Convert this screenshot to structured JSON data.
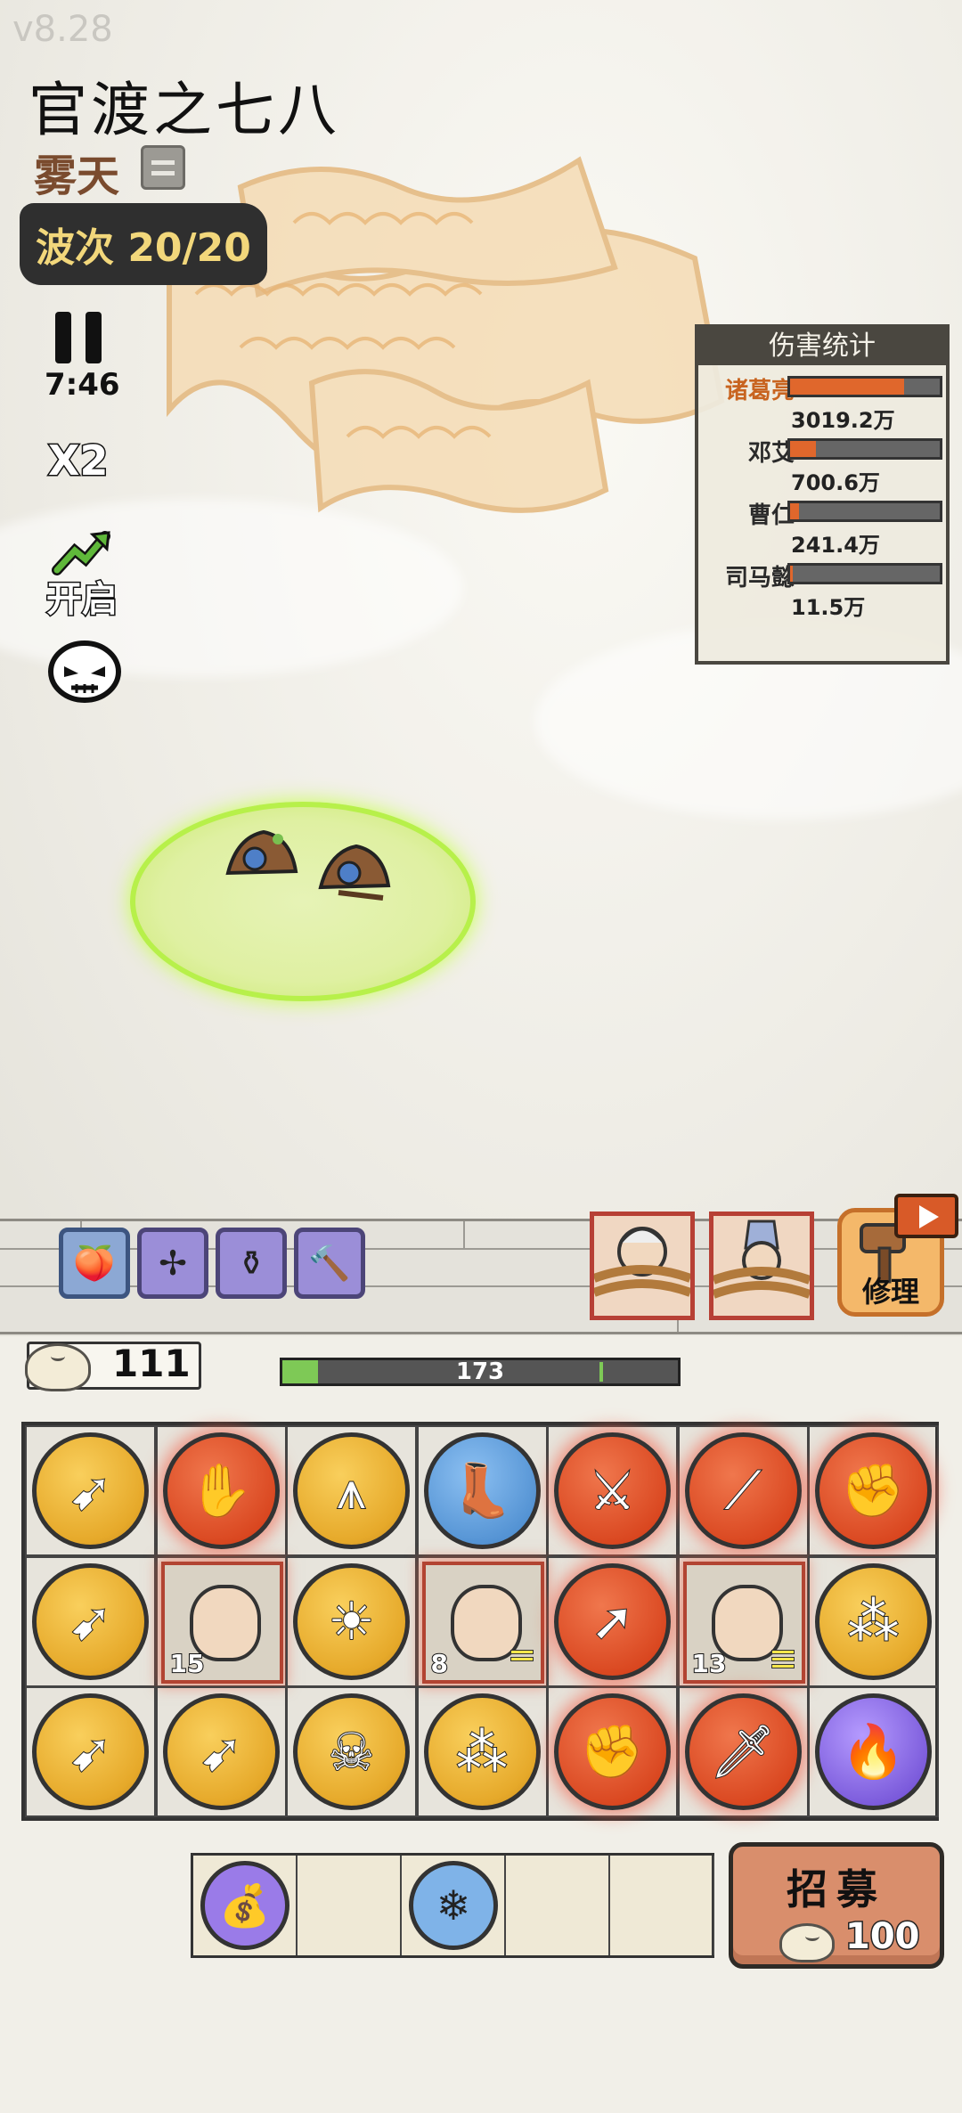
{
  "version": "v8.28",
  "stage": {
    "title": "官渡之七八",
    "weather": "雾天"
  },
  "wave": {
    "label": "波次 20/20"
  },
  "controls": {
    "timer": "7:46",
    "speed": "X2",
    "boost_label": "开启"
  },
  "damage_stats": {
    "title": "伤害统计",
    "rows": [
      {
        "name": "诸葛亮",
        "value": "3019.2万",
        "ratio": 0.76
      },
      {
        "name": "邓艾",
        "value": "700.6万",
        "ratio": 0.17
      },
      {
        "name": "曹仁",
        "value": "241.4万",
        "ratio": 0.06
      },
      {
        "name": "司马懿",
        "value": "11.5万",
        "ratio": 0.005
      }
    ]
  },
  "wall": {
    "repair_label": "修理",
    "hp_value": "173",
    "hp_fraction": 0.09
  },
  "resources": {
    "buns": "111"
  },
  "item_slots": [
    {
      "icon": "peach-icon",
      "glyph": "🍑"
    },
    {
      "icon": "shuriken-plus-icon",
      "glyph": "✢"
    },
    {
      "icon": "jar-icon",
      "glyph": "⚱"
    },
    {
      "icon": "hammer-icon",
      "glyph": "🔨"
    }
  ],
  "grid": {
    "rows": [
      [
        {
          "kind": "unit",
          "color": "gold",
          "icon": "flaming-arrow-icon",
          "glyph": "➹"
        },
        {
          "kind": "unit",
          "color": "red",
          "icon": "glove-icon",
          "glyph": "✋"
        },
        {
          "kind": "unit",
          "color": "gold",
          "icon": "triple-blade-icon",
          "glyph": "⩚"
        },
        {
          "kind": "unit",
          "color": "blue",
          "icon": "boot-icon",
          "glyph": "👢"
        },
        {
          "kind": "unit",
          "color": "red",
          "icon": "sword-up-icon",
          "glyph": "⚔"
        },
        {
          "kind": "unit",
          "color": "red",
          "icon": "twin-spears-icon",
          "glyph": "⟋"
        },
        {
          "kind": "unit",
          "color": "red",
          "icon": "crystal-fists-icon",
          "glyph": "✊"
        }
      ],
      [
        {
          "kind": "unit",
          "color": "gold",
          "icon": "flaming-arrow-icon",
          "glyph": "➹"
        },
        {
          "kind": "hero",
          "level": "15",
          "icon": "hero-bearded-sage",
          "bars": 0
        },
        {
          "kind": "unit",
          "color": "gold",
          "icon": "sun-icon",
          "glyph": "☀"
        },
        {
          "kind": "hero",
          "level": "8",
          "icon": "hero-long-hair-warrior",
          "bars": 2
        },
        {
          "kind": "unit",
          "color": "red",
          "icon": "arrow-up-right-icon",
          "glyph": "➚"
        },
        {
          "kind": "hero",
          "level": "13",
          "icon": "hero-miner",
          "bars": 3
        },
        {
          "kind": "unit",
          "color": "gold",
          "icon": "tri-arrows-icon",
          "glyph": "⁂"
        }
      ],
      [
        {
          "kind": "unit",
          "color": "gold",
          "icon": "flaming-arrow-icon",
          "glyph": "➹"
        },
        {
          "kind": "unit",
          "color": "gold",
          "icon": "flaming-arrow-icon",
          "glyph": "➹"
        },
        {
          "kind": "unit",
          "color": "gold",
          "icon": "skull-icon",
          "glyph": "☠"
        },
        {
          "kind": "unit",
          "color": "gold",
          "icon": "tri-arrows-icon",
          "glyph": "⁂"
        },
        {
          "kind": "unit",
          "color": "red",
          "icon": "crystal-fists-icon",
          "glyph": "✊"
        },
        {
          "kind": "unit",
          "color": "red",
          "icon": "sword-rank-icon",
          "glyph": "🗡"
        },
        {
          "kind": "unit",
          "color": "purple",
          "icon": "flame-icon",
          "glyph": "🔥"
        }
      ]
    ]
  },
  "bag": [
    {
      "icon": "fortune-bag-icon",
      "glyph": "💰",
      "color": "#9a7be8"
    },
    null,
    {
      "icon": "ice-crystal-icon",
      "glyph": "❄",
      "color": "#7fb3e8"
    },
    null,
    null
  ],
  "recruit": {
    "label": "招募",
    "cost": "100"
  }
}
